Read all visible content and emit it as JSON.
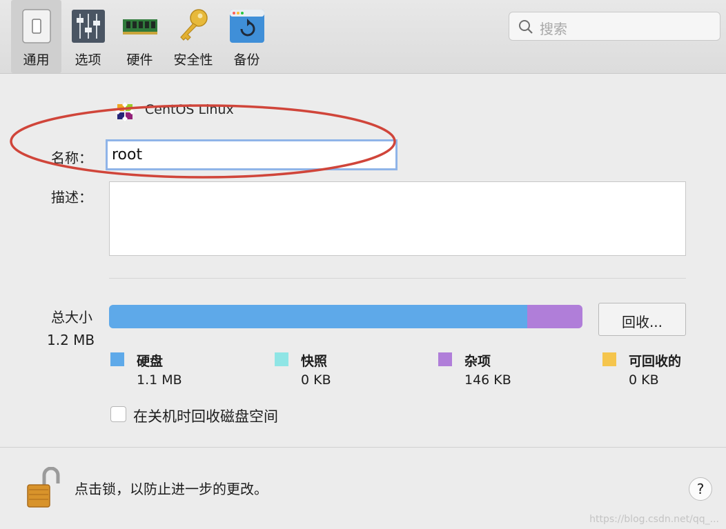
{
  "toolbar": {
    "tabs": [
      {
        "label": "通用",
        "icon": "general-switch-icon",
        "active": true
      },
      {
        "label": "选项",
        "icon": "sliders-icon",
        "active": false
      },
      {
        "label": "硬件",
        "icon": "memory-chip-icon",
        "active": false
      },
      {
        "label": "安全性",
        "icon": "key-icon",
        "active": false
      },
      {
        "label": "备份",
        "icon": "backup-icon",
        "active": false
      }
    ],
    "search_placeholder": "搜索"
  },
  "general": {
    "os_name": "CentOS Linux",
    "name_label": "名称：",
    "name_value": "root",
    "description_label": "描述：",
    "description_value": "",
    "total_size_label": "总大小",
    "total_size_value": "1.2 MB",
    "reclaim_button": "回收...",
    "usage": [
      {
        "name": "硬盘",
        "value": "1.1 MB",
        "fraction": 0.884,
        "color": "#5ea9e9"
      },
      {
        "name": "快照",
        "value": "0 KB",
        "fraction": 0.0,
        "color": "#8fe5e5"
      },
      {
        "name": "杂项",
        "value": "146 KB",
        "fraction": 0.116,
        "color": "#b07ed9"
      },
      {
        "name": "可回收的",
        "value": "0 KB",
        "fraction": 0.0,
        "color": "#f5c54d"
      }
    ],
    "reclaim_on_shutdown_label": "在关机时回收磁盘空间",
    "reclaim_on_shutdown_checked": false
  },
  "footer": {
    "lock_text": "点击锁，以防止进一步的更改。",
    "help_label": "?"
  },
  "watermark": "https://blog.csdn.net/qq_..."
}
